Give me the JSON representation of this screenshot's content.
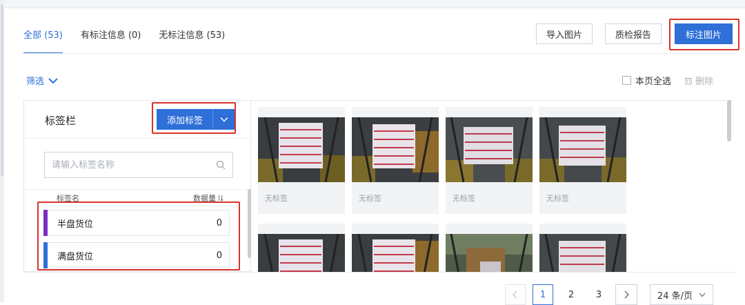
{
  "tabs": [
    {
      "label": "全部 (53)",
      "active": true
    },
    {
      "label": "有标注信息 (0)",
      "active": false
    },
    {
      "label": "无标注信息 (53)",
      "active": false
    }
  ],
  "toolbar": {
    "import_label": "导入图片",
    "qc_label": "质检报告",
    "annotate_label": "标注图片"
  },
  "filter": {
    "label": "筛选",
    "icon": "chevron-down-icon"
  },
  "select_all_label": "本页全选",
  "delete_label": "删除",
  "label_panel": {
    "title": "标签栏",
    "add_button": "添加标签",
    "search_placeholder": "请输入标签名称",
    "col_name": "标签名",
    "col_count": "数据量",
    "labels": [
      {
        "name": "半盘货位",
        "count": "0",
        "color": "#7b2fc4"
      },
      {
        "name": "满盘货位",
        "count": "0",
        "color": "#2e6fd8"
      }
    ]
  },
  "images": {
    "caption": "无标签",
    "cards": [
      {
        "caption": "无标签"
      },
      {
        "caption": "无标签"
      },
      {
        "caption": "无标签"
      },
      {
        "caption": "无标签"
      },
      {
        "caption": ""
      },
      {
        "caption": ""
      },
      {
        "caption": ""
      },
      {
        "caption": ""
      }
    ]
  },
  "pagination": {
    "pages": [
      "1",
      "2",
      "3"
    ],
    "current": "1",
    "page_size": "24 条/页"
  },
  "colors": {
    "primary": "#2e6fd8",
    "highlight": "#d9322a"
  }
}
